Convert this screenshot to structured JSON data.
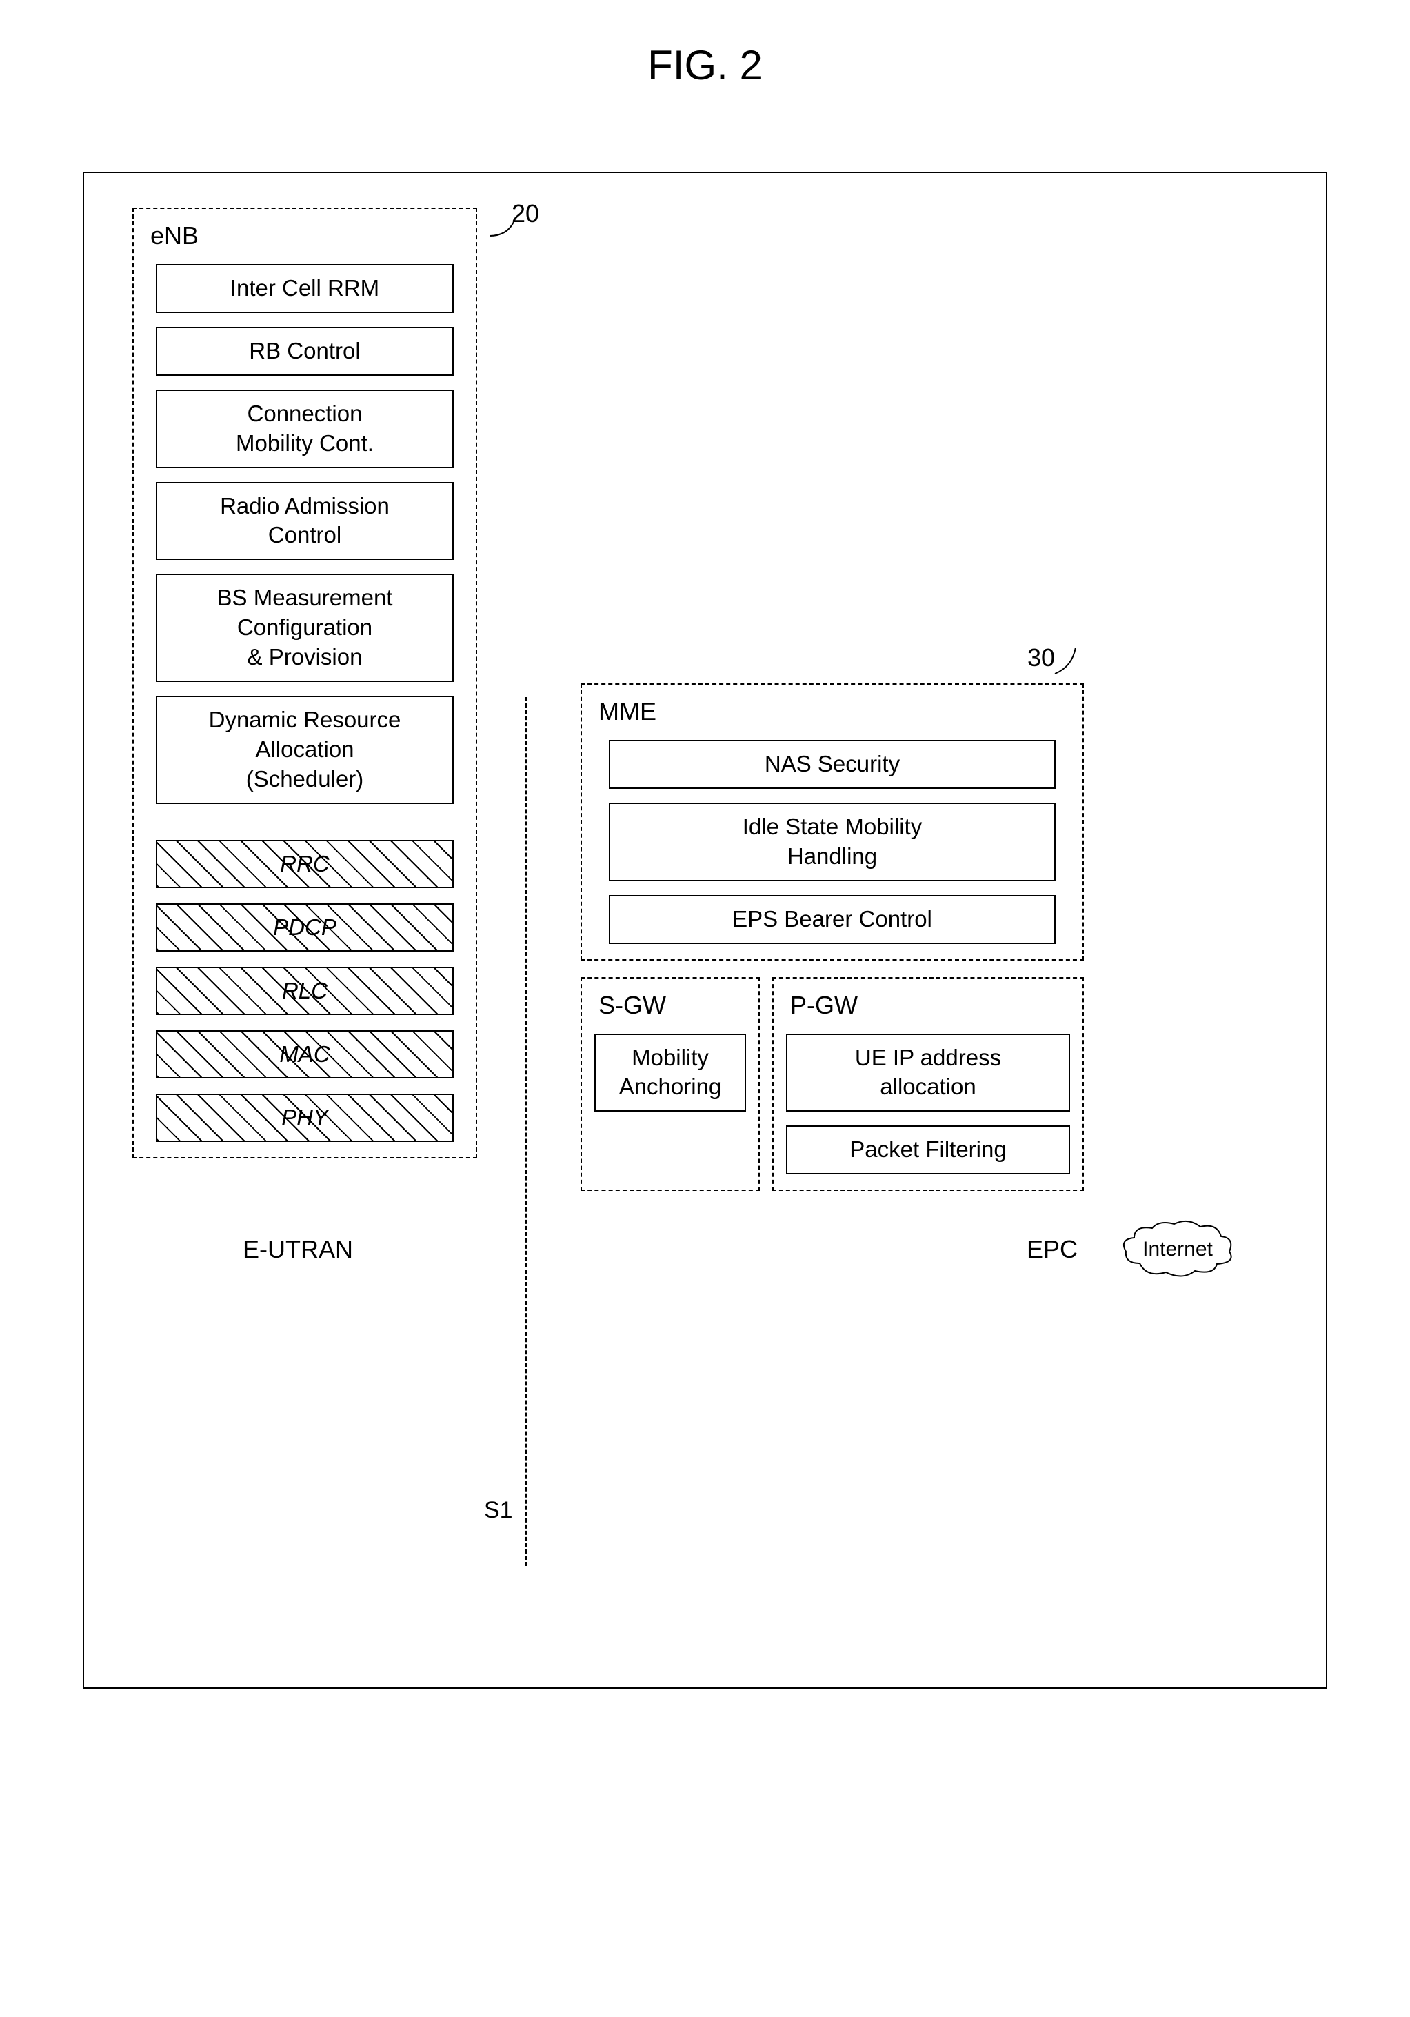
{
  "figure_title": "FIG. 2",
  "enb": {
    "title": "eNB",
    "ref": "20",
    "functions": [
      "Inter Cell RRM",
      "RB Control",
      "Connection\nMobility Cont.",
      "Radio Admission\nControl",
      "BS Measurement\nConfiguration\n& Provision",
      "Dynamic Resource\nAllocation\n(Scheduler)"
    ],
    "layers": [
      "RRC",
      "PDCP",
      "RLC",
      "MAC",
      "PHY"
    ]
  },
  "mme": {
    "title": "MME",
    "ref": "30",
    "functions": [
      "NAS Security",
      "Idle State Mobility\nHandling",
      "EPS Bearer Control"
    ]
  },
  "sgw": {
    "title": "S-GW",
    "functions": [
      "Mobility\nAnchoring"
    ]
  },
  "pgw": {
    "title": "P-GW",
    "functions": [
      "UE IP address\nallocation",
      "Packet Filtering"
    ]
  },
  "interface": "S1",
  "regions": {
    "left": "E-UTRAN",
    "right": "EPC",
    "external": "Internet"
  }
}
